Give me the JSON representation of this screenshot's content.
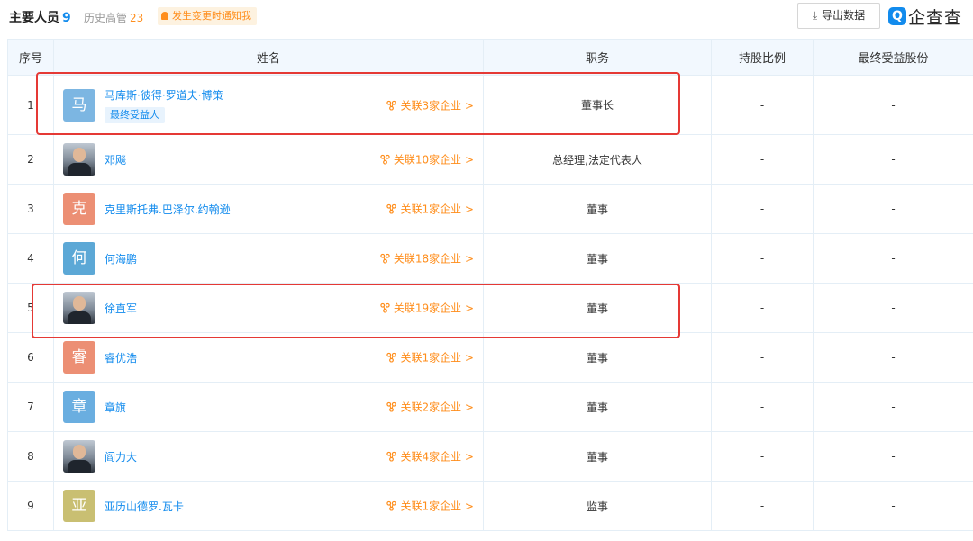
{
  "header": {
    "title": "主要人员",
    "title_count": "9",
    "history_label": "历史高管",
    "history_count": "23",
    "notify_label": "发生变更时通知我",
    "export_label": "导出数据",
    "logo_text": "企查查"
  },
  "table": {
    "columns": [
      "序号",
      "姓名",
      "职务",
      "持股比例",
      "最终受益股份"
    ],
    "rows": [
      {
        "idx": "1",
        "avatar_char": "马",
        "avatar_color": "#7cb6e2",
        "photo": false,
        "name": "马库斯·彼得·罗道夫·博策",
        "tag": "最终受益人",
        "related": "关联3家企业 >",
        "role": "董事长",
        "share": "-",
        "benefit": "-"
      },
      {
        "idx": "2",
        "avatar_char": "",
        "avatar_color": "",
        "photo": true,
        "name": "邓飚",
        "tag": "",
        "related": "关联10家企业 >",
        "role": "总经理,法定代表人",
        "share": "-",
        "benefit": "-"
      },
      {
        "idx": "3",
        "avatar_char": "克",
        "avatar_color": "#ec8f74",
        "photo": false,
        "name": "克里斯托弗.巴泽尔.约翰逊",
        "tag": "",
        "related": "关联1家企业 >",
        "role": "董事",
        "share": "-",
        "benefit": "-"
      },
      {
        "idx": "4",
        "avatar_char": "何",
        "avatar_color": "#5ca8d6",
        "photo": false,
        "name": "何海鹏",
        "tag": "",
        "related": "关联18家企业 >",
        "role": "董事",
        "share": "-",
        "benefit": "-"
      },
      {
        "idx": "5",
        "avatar_char": "",
        "avatar_color": "",
        "photo": true,
        "name": "徐直军",
        "tag": "",
        "related": "关联19家企业 >",
        "role": "董事",
        "share": "-",
        "benefit": "-"
      },
      {
        "idx": "6",
        "avatar_char": "睿",
        "avatar_color": "#ec8f74",
        "photo": false,
        "name": "睿优浩",
        "tag": "",
        "related": "关联1家企业 >",
        "role": "董事",
        "share": "-",
        "benefit": "-"
      },
      {
        "idx": "7",
        "avatar_char": "章",
        "avatar_color": "#6aaee0",
        "photo": false,
        "name": "章旗",
        "tag": "",
        "related": "关联2家企业 >",
        "role": "董事",
        "share": "-",
        "benefit": "-"
      },
      {
        "idx": "8",
        "avatar_char": "",
        "avatar_color": "",
        "photo": true,
        "name": "阎力大",
        "tag": "",
        "related": "关联4家企业 >",
        "role": "董事",
        "share": "-",
        "benefit": "-"
      },
      {
        "idx": "9",
        "avatar_char": "亚",
        "avatar_color": "#c9bf72",
        "photo": false,
        "name": "亚历山德罗.瓦卡",
        "tag": "",
        "related": "关联1家企业 >",
        "role": "监事",
        "share": "-",
        "benefit": "-"
      }
    ]
  },
  "colors": {
    "accent": "#128bed",
    "orange": "#ff8e1c",
    "highlight": "#e53935"
  }
}
